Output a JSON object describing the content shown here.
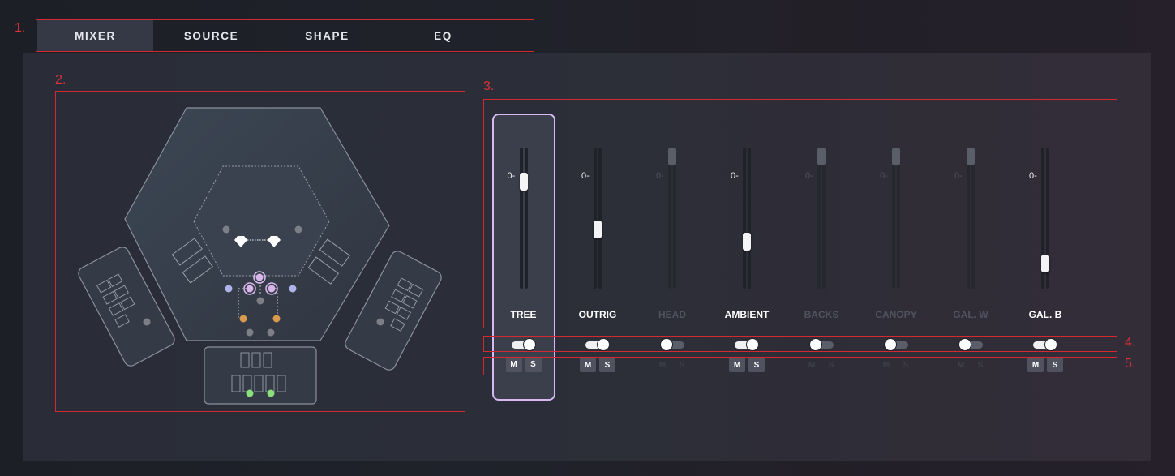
{
  "tabs": [
    {
      "label": "MIXER",
      "active": true
    },
    {
      "label": "SOURCE",
      "active": false
    },
    {
      "label": "SHAPE",
      "active": false
    },
    {
      "label": "EQ",
      "active": false
    }
  ],
  "markers": {
    "m1": "1.",
    "m2": "2.",
    "m3": "3.",
    "m4": "4.",
    "m5": "5."
  },
  "channels": [
    {
      "name": "TREE",
      "level_label": "0-",
      "fader_fraction": 0.79,
      "enabled": true,
      "selected": true,
      "stereo_on": true,
      "mute_label": "M",
      "solo_label": "S"
    },
    {
      "name": "OUTRIG",
      "level_label": "0-",
      "fader_fraction": 0.41,
      "enabled": true,
      "selected": false,
      "stereo_on": true,
      "mute_label": "M",
      "solo_label": "S"
    },
    {
      "name": "HEAD",
      "level_label": "0-",
      "fader_fraction": 1.0,
      "enabled": false,
      "selected": false,
      "stereo_on": false,
      "mute_label": "M",
      "solo_label": "S"
    },
    {
      "name": "AMBIENT",
      "level_label": "0-",
      "fader_fraction": 0.31,
      "enabled": true,
      "selected": false,
      "stereo_on": true,
      "mute_label": "M",
      "solo_label": "S"
    },
    {
      "name": "BACKS",
      "level_label": "0-",
      "fader_fraction": 1.0,
      "enabled": false,
      "selected": false,
      "stereo_on": false,
      "mute_label": "M",
      "solo_label": "S"
    },
    {
      "name": "CANOPY",
      "level_label": "0-",
      "fader_fraction": 1.0,
      "enabled": false,
      "selected": false,
      "stereo_on": false,
      "mute_label": "M",
      "solo_label": "S"
    },
    {
      "name": "GAL. W",
      "level_label": "0-",
      "fader_fraction": 1.0,
      "enabled": false,
      "selected": false,
      "stereo_on": false,
      "mute_label": "M",
      "solo_label": "S"
    },
    {
      "name": "GAL. B",
      "level_label": "0-",
      "fader_fraction": 0.13,
      "enabled": true,
      "selected": false,
      "stereo_on": true,
      "mute_label": "M",
      "solo_label": "S"
    }
  ],
  "colors": {
    "annotation_red": "#d42a2f",
    "selected_outline": "#d8b8f2",
    "mic_lavender": "#d9b6ea",
    "mic_blue": "#aeb4ea",
    "mic_orange": "#d89a4e",
    "mic_green": "#8be07a",
    "mic_grey": "#7d7f86"
  }
}
